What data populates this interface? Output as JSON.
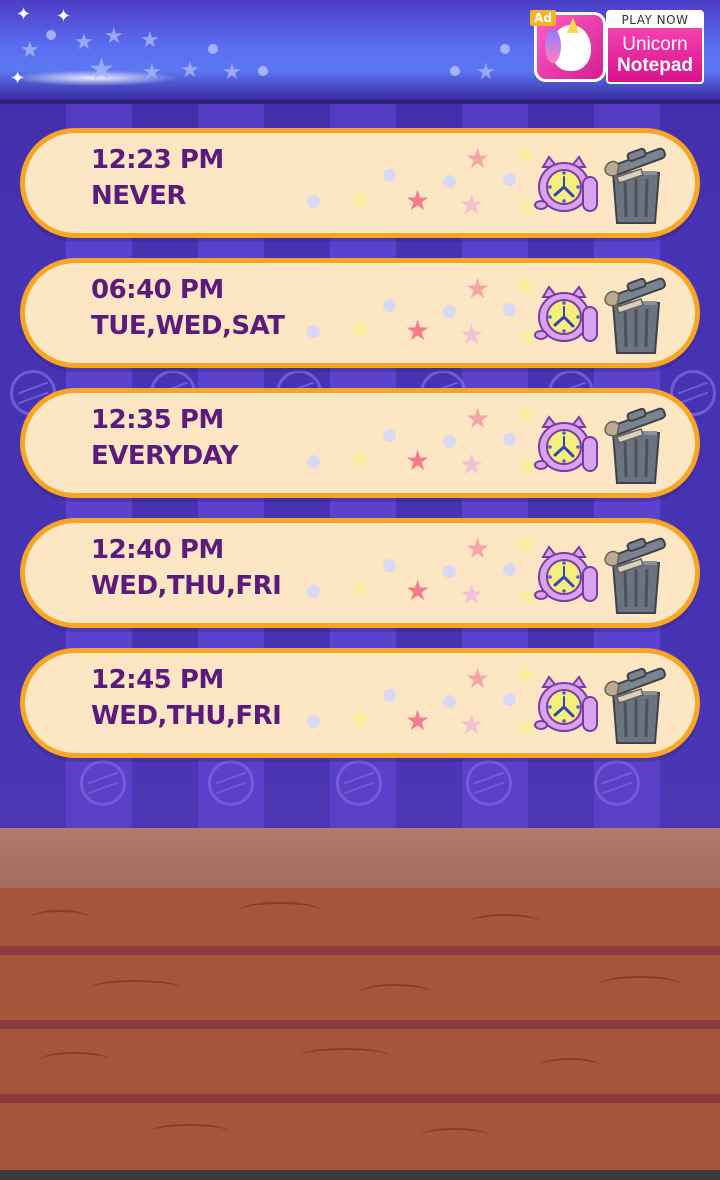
{
  "ad": {
    "tag": "Ad",
    "cta": "PLAY NOW",
    "title_line1": "Unicorn",
    "title_line2": "Notepad",
    "icon": "unicorn-notepad-app-icon"
  },
  "alarms": [
    {
      "time": "12:23 PM",
      "days": "NEVER"
    },
    {
      "time": "06:40 PM",
      "days": "TUE,WED,SAT"
    },
    {
      "time": "12:35 PM",
      "days": "EVERYDAY"
    },
    {
      "time": "12:40 PM",
      "days": "WED,THU,FRI"
    },
    {
      "time": "12:45 PM",
      "days": "WED,THU,FRI"
    }
  ],
  "icons": {
    "alarm_toggle": "cat-alarm-clock-icon",
    "delete": "trash-can-icon"
  },
  "colors": {
    "row_fill": "#fde6c4",
    "row_border": "#f6a623",
    "text": "#5b1a7c",
    "wall_dark": "#4633b4",
    "wall_light": "#5a42cf",
    "floor": "#a6543a"
  }
}
